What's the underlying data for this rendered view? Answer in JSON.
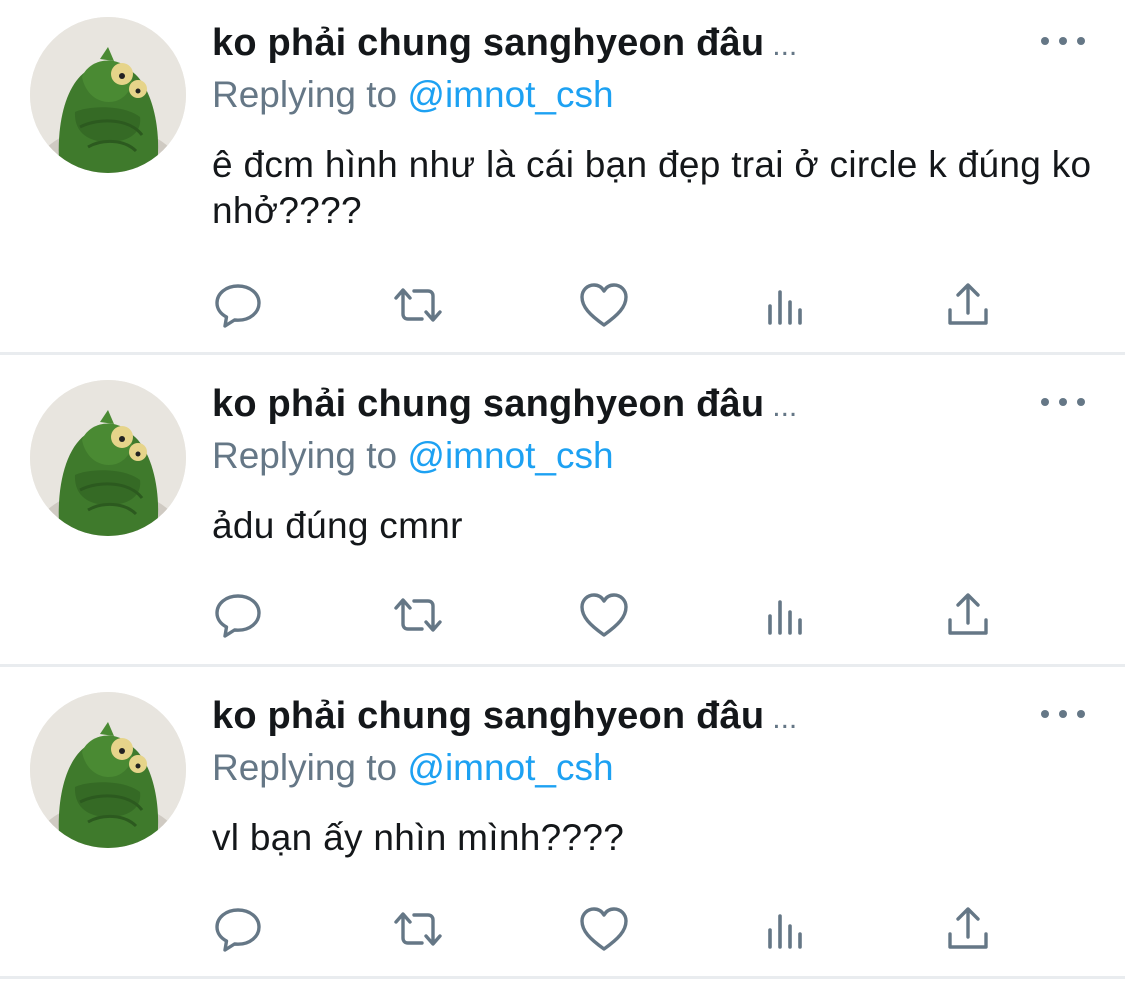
{
  "tweets": [
    {
      "display_name": "ko phải chung sanghyeon đâu",
      "name_overflow": "...",
      "replying_prefix": "Replying to",
      "reply_handle": "@imnot_csh",
      "text": "ê đcm hình như là cái bạn đẹp trai ở circle k đúng ko nhở????"
    },
    {
      "display_name": "ko phải chung sanghyeon đâu",
      "name_overflow": "...",
      "replying_prefix": "Replying to",
      "reply_handle": "@imnot_csh",
      "text": "ảdu đúng cmnr"
    },
    {
      "display_name": "ko phải chung sanghyeon đâu",
      "name_overflow": "...",
      "replying_prefix": "Replying to",
      "reply_handle": "@imnot_csh",
      "text": "vl bạn ấy nhìn mình????"
    }
  ],
  "icons": {
    "reply": "reply-icon",
    "retweet": "retweet-icon",
    "like": "heart-icon",
    "analytics": "analytics-icon",
    "share": "share-icon",
    "more": "more-icon"
  },
  "colors": {
    "link": "#1da1f2",
    "secondary_text": "#657786",
    "primary_text": "#14171a",
    "divider": "#e9ecef"
  }
}
